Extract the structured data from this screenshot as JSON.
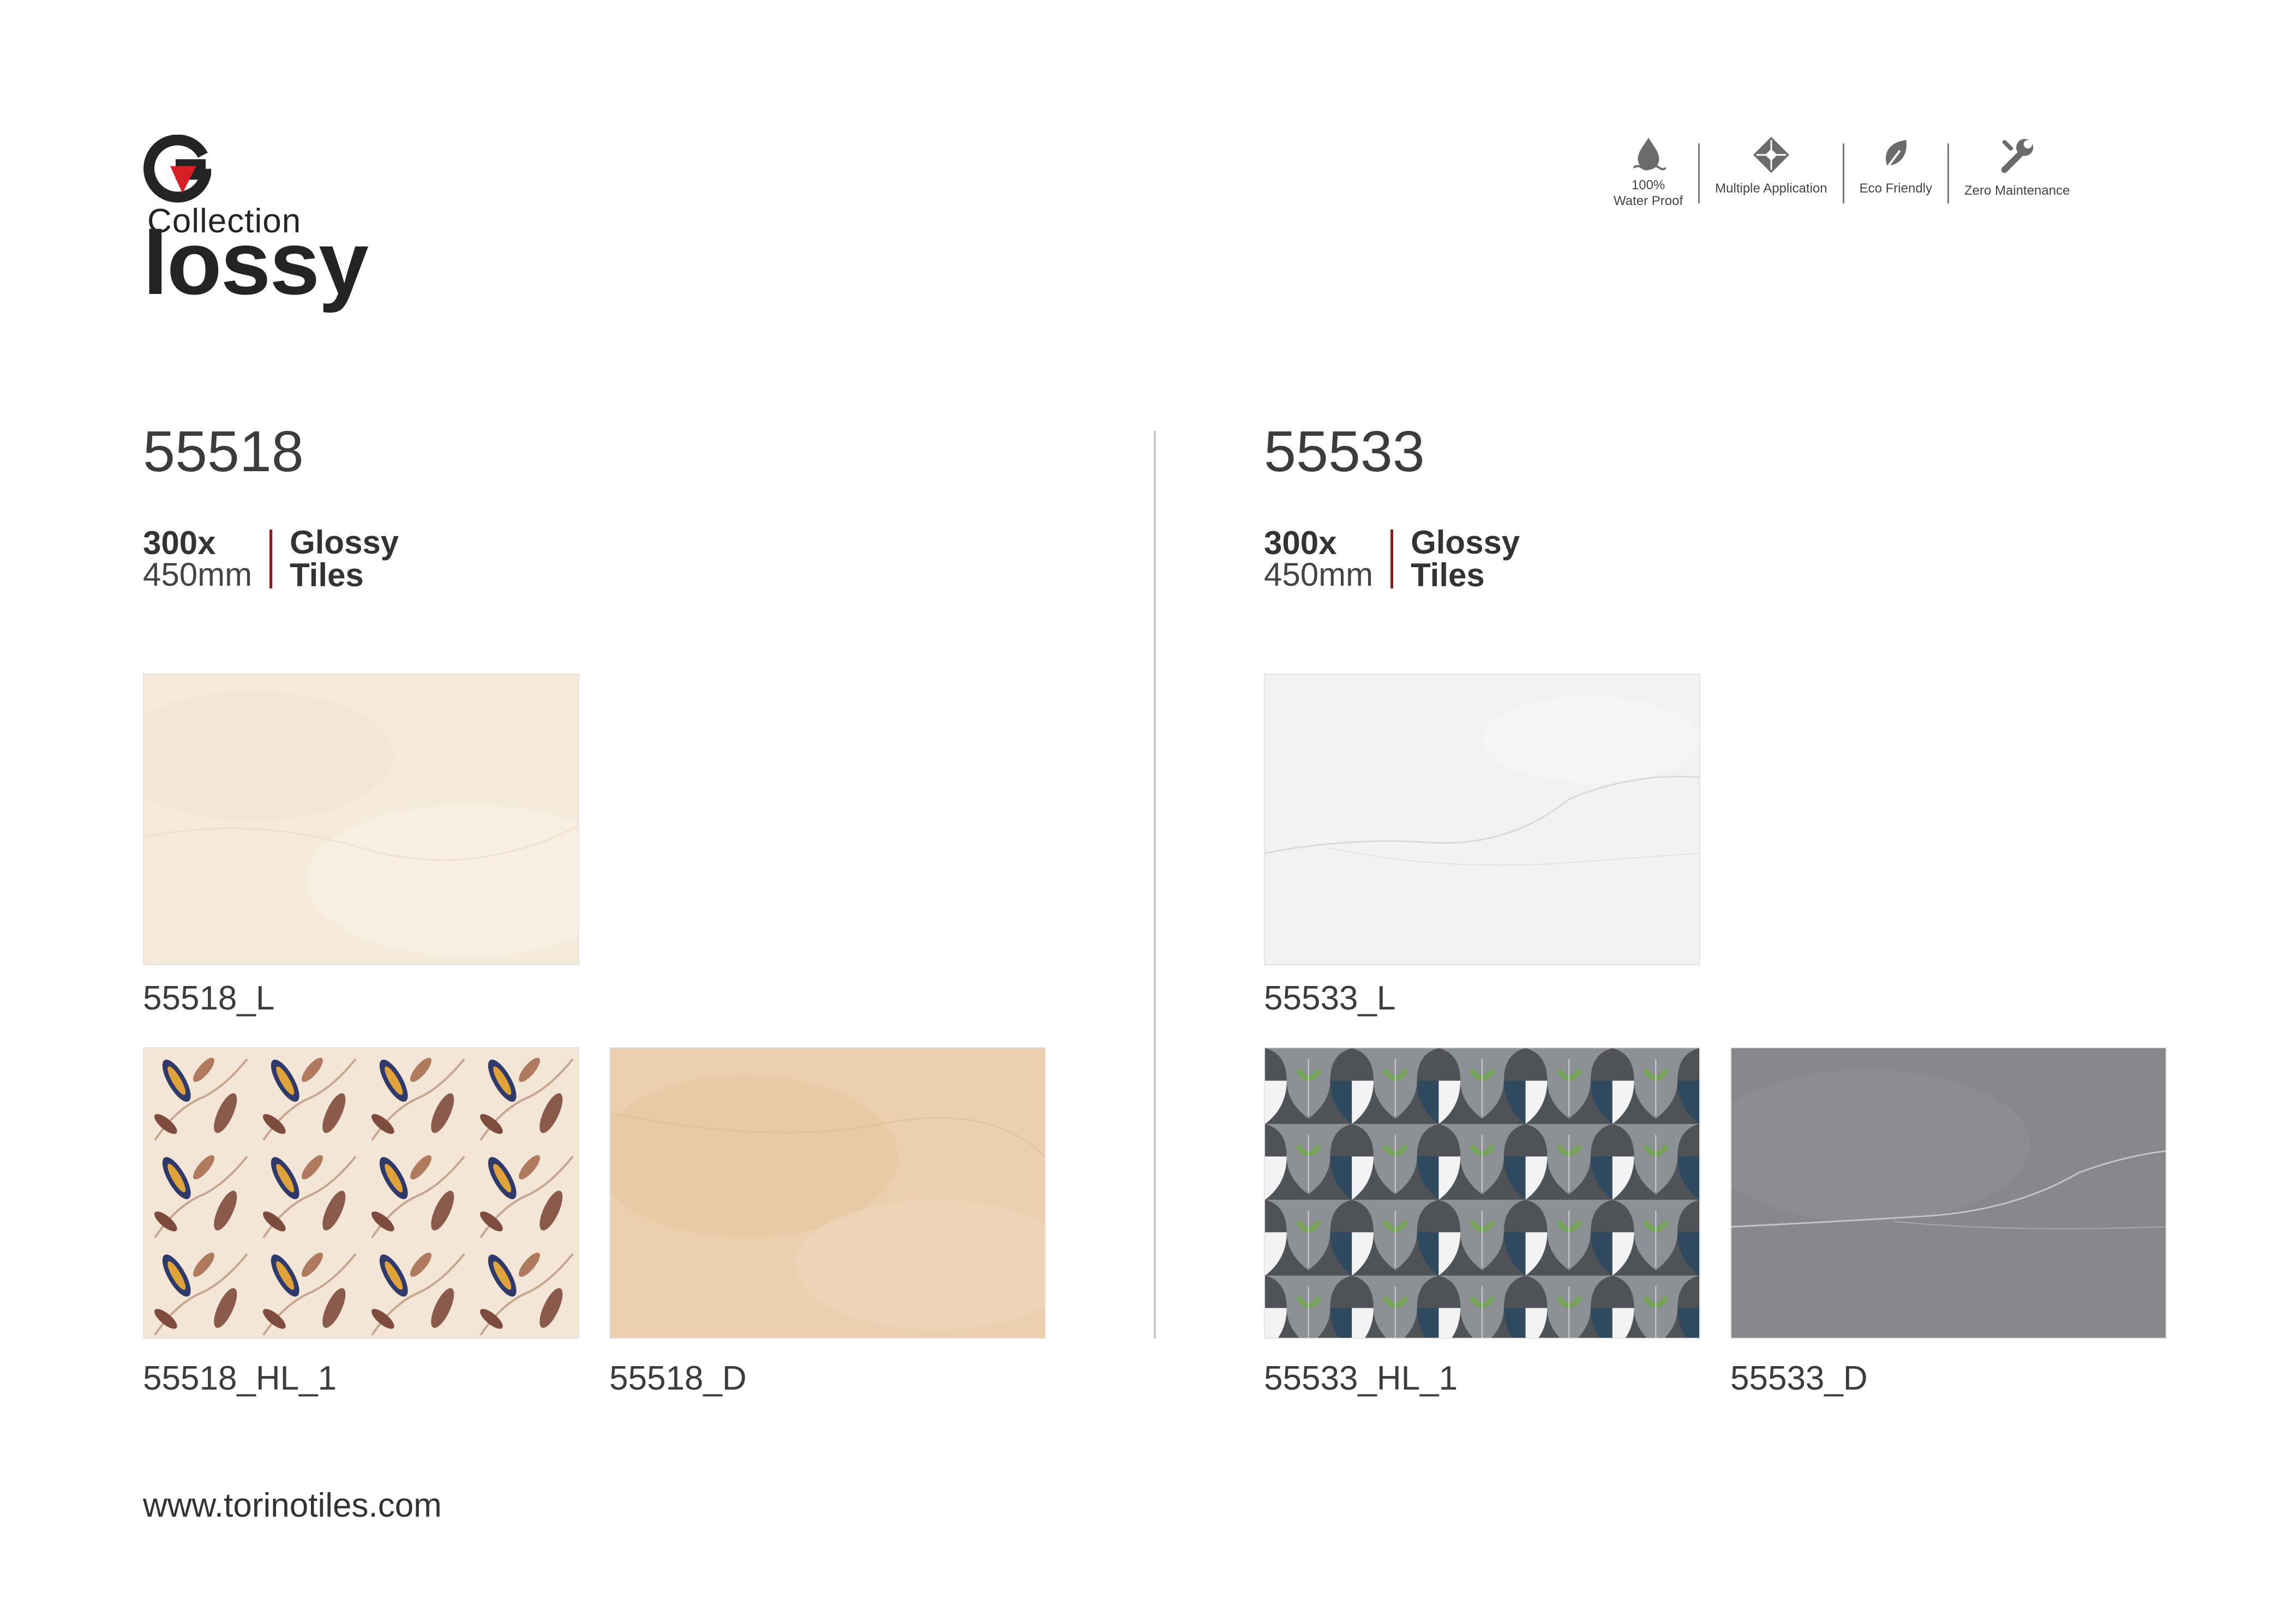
{
  "brand": {
    "logo_word": "lossy",
    "logo_first_letter": "G",
    "logo_sub": "Collection",
    "accent_color": "#d81f26",
    "dark_color": "#242424"
  },
  "features": [
    {
      "label_line1": "100%",
      "label_line2": "Water Proof",
      "icon": "water-drop-icon"
    },
    {
      "label_line1": "",
      "label_line2": "Multiple Application",
      "icon": "tiles-pattern-icon"
    },
    {
      "label_line1": "",
      "label_line2": "Eco Friendly",
      "icon": "leaf-icon"
    },
    {
      "label_line1": "",
      "label_line2": "Zero Maintenance",
      "icon": "tools-icon"
    }
  ],
  "products": [
    {
      "code": "55518",
      "size_line1": "300x",
      "size_line2": "450mm",
      "type_line1": "Glossy",
      "type_line2": "Tiles",
      "tiles": [
        {
          "caption": "55518_L",
          "pattern": "cream-marble",
          "color": "#f6eadb"
        },
        {
          "caption": "55518_HL_1",
          "pattern": "leaf-floral",
          "color": "#f3e6d6"
        },
        {
          "caption": "55518_D",
          "pattern": "beige-marble",
          "color": "#ebcfae"
        }
      ]
    },
    {
      "code": "55533",
      "size_line1": "300x",
      "size_line2": "450mm",
      "type_line1": "Glossy",
      "type_line2": "Tiles",
      "tiles": [
        {
          "caption": "55533_L",
          "pattern": "white-marble",
          "color": "#f2f2f1"
        },
        {
          "caption": "55533_HL_1",
          "pattern": "grey-leaf-scales",
          "color": "#6d7076"
        },
        {
          "caption": "55533_D",
          "pattern": "grey-marble",
          "color": "#86888c"
        }
      ]
    }
  ],
  "footer": {
    "website": "www.torinotiles.com"
  }
}
